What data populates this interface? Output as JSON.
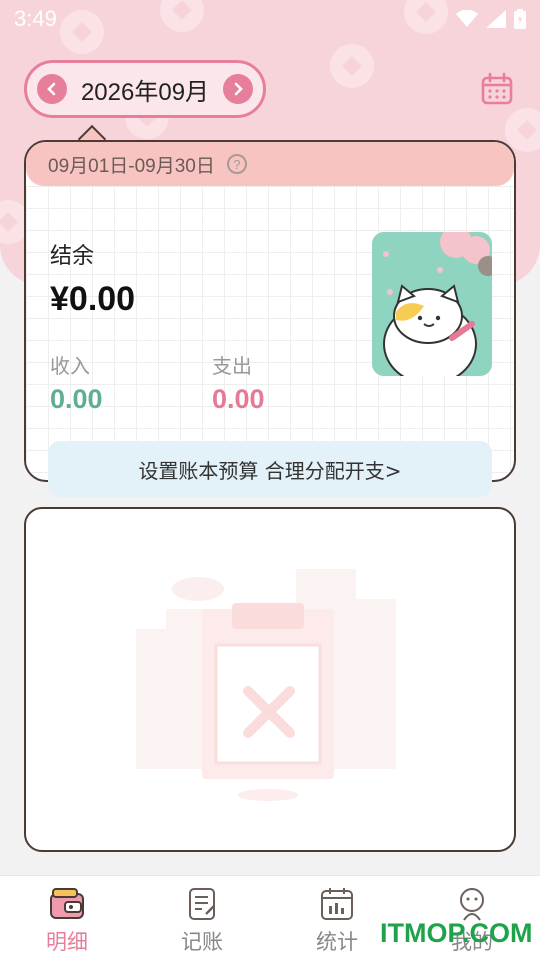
{
  "status_bar": {
    "time": "3:49"
  },
  "header": {
    "month": "2026年09月",
    "prev_icon": "chevron-left-icon",
    "next_icon": "chevron-right-icon",
    "calendar_icon": "calendar-icon"
  },
  "summary": {
    "date_range": "09月01日-09月30日",
    "help_icon": "question-icon",
    "balance_label": "结余",
    "balance_value": "¥0.00",
    "income_label": "收入",
    "income_value": "0.00",
    "expense_label": "支出",
    "expense_value": "0.00",
    "budget_banner": "设置账本预算 合理分配开支>"
  },
  "colors": {
    "accent_pink": "#e77f9b",
    "income_green": "#5fae94",
    "expense_pink": "#e57996",
    "header_bg": "#f7d3da"
  },
  "bottom_nav": {
    "items": [
      {
        "label": "明细",
        "icon": "wallet-icon",
        "active": true
      },
      {
        "label": "记账",
        "icon": "notebook-icon",
        "active": false
      },
      {
        "label": "统计",
        "icon": "chart-calendar-icon",
        "active": false
      },
      {
        "label": "我的",
        "icon": "profile-icon",
        "active": false
      }
    ]
  },
  "watermark": "ITMOP.COM"
}
